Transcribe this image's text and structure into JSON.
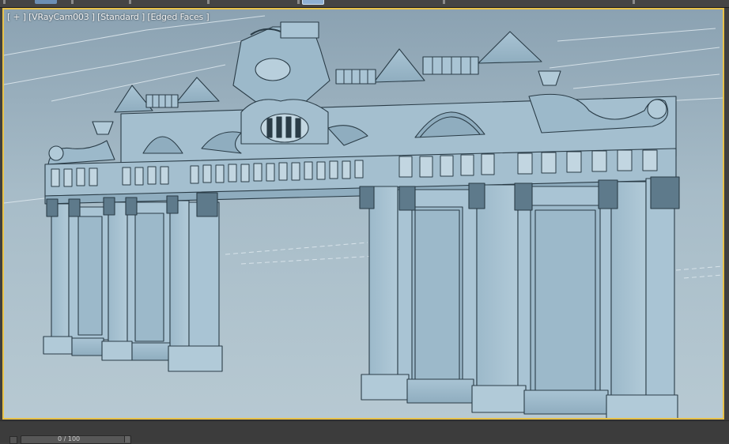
{
  "viewport": {
    "label": "[ + ] [VRayCam003 ] [Standard ] [Edged Faces ]",
    "shading_mode": "Edged Faces",
    "active_border_color": "#e7c24a",
    "background_color": "#9eb3c0"
  },
  "time_slider": {
    "label": "0 / 100"
  },
  "toolbar": {
    "active_button_color": "#8fb0d3"
  }
}
